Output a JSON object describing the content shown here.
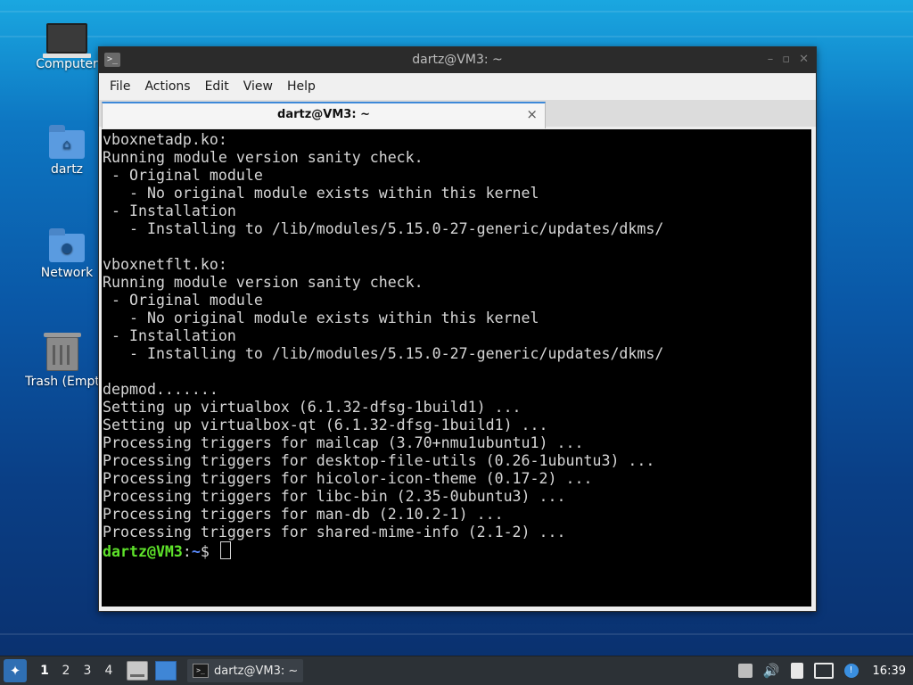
{
  "desktop": {
    "icons": [
      {
        "label": "Computer",
        "icon": "computer-icon"
      },
      {
        "label": "dartz",
        "icon": "home-folder-icon"
      },
      {
        "label": "Network",
        "icon": "network-folder-icon"
      },
      {
        "label": "Trash (Empt",
        "icon": "trash-icon"
      }
    ]
  },
  "window": {
    "title": "dartz@VM3: ~",
    "menu": [
      "File",
      "Actions",
      "Edit",
      "View",
      "Help"
    ],
    "tab_title": "dartz@VM3: ~",
    "tab_close": "×",
    "icon_glyph": ">_"
  },
  "terminal": {
    "lines": [
      "vboxnetadp.ko:",
      "Running module version sanity check.",
      " - Original module",
      "   - No original module exists within this kernel",
      " - Installation",
      "   - Installing to /lib/modules/5.15.0-27-generic/updates/dkms/",
      "",
      "vboxnetflt.ko:",
      "Running module version sanity check.",
      " - Original module",
      "   - No original module exists within this kernel",
      " - Installation",
      "   - Installing to /lib/modules/5.15.0-27-generic/updates/dkms/",
      "",
      "depmod.......",
      "Setting up virtualbox (6.1.32-dfsg-1build1) ...",
      "Setting up virtualbox-qt (6.1.32-dfsg-1build1) ...",
      "Processing triggers for mailcap (3.70+nmu1ubuntu1) ...",
      "Processing triggers for desktop-file-utils (0.26-1ubuntu3) ...",
      "Processing triggers for hicolor-icon-theme (0.17-2) ...",
      "Processing triggers for libc-bin (2.35-0ubuntu3) ...",
      "Processing triggers for man-db (2.10.2-1) ...",
      "Processing triggers for shared-mime-info (2.1-2) ..."
    ],
    "prompt": {
      "user": "dartz@VM3",
      "colon": ":",
      "path": "~",
      "symbol": "$ "
    }
  },
  "taskbar": {
    "workspaces": [
      "1",
      "2",
      "3",
      "4"
    ],
    "active_workspace": "1",
    "task_label": "dartz@VM3: ~",
    "task_glyph": ">_",
    "clock": "16:39",
    "volume_glyph": "🔊",
    "update_glyph": "!"
  },
  "colors": {
    "prompt_user": "#5ee32a",
    "prompt_path": "#5b8cff",
    "terminal_bg": "#000000",
    "tab_accent": "#3d89d8"
  }
}
